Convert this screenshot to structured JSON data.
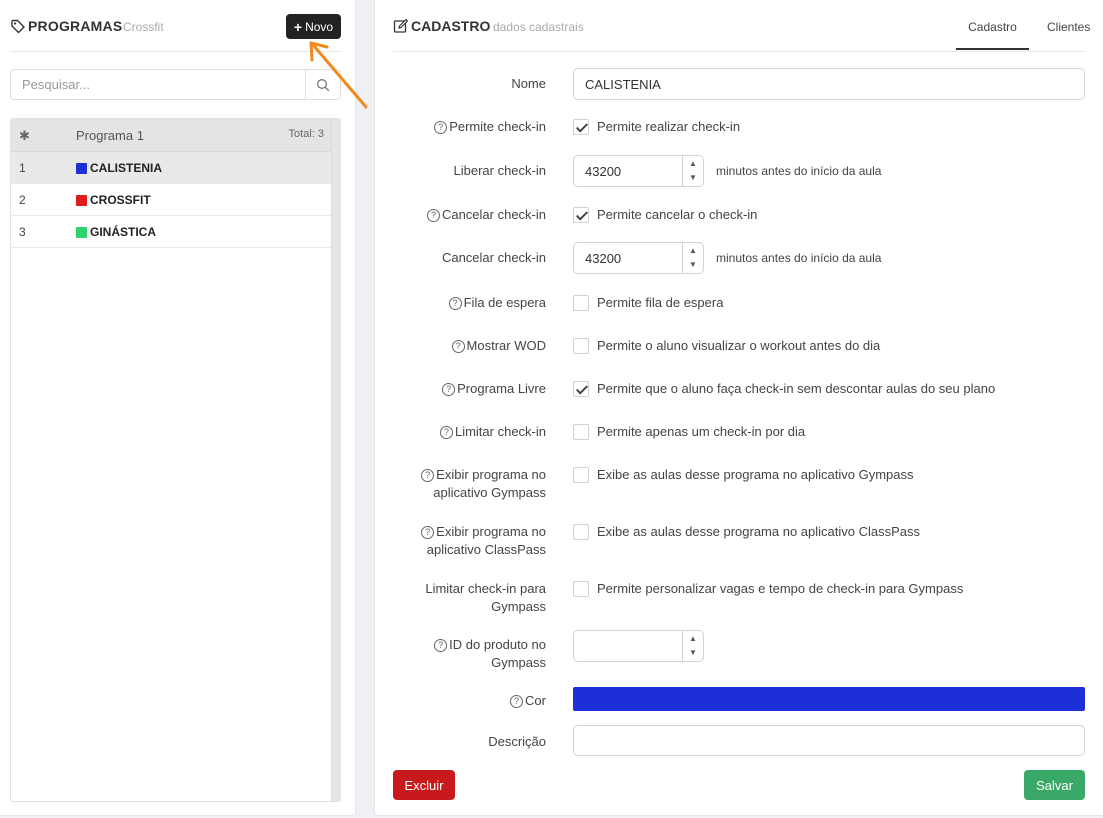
{
  "programs_panel": {
    "title": "PROGRAMAS",
    "subtitle": "Crossfit",
    "new_button": "Novo",
    "search_placeholder": "Pesquisar...",
    "list_header": {
      "column": "Programa 1",
      "total": "Total: 3"
    },
    "items": [
      {
        "num": "1",
        "name": "CALISTENIA",
        "color": "#1d30d8",
        "selected": true
      },
      {
        "num": "2",
        "name": "CROSSFIT",
        "color": "#e01b1b",
        "selected": false
      },
      {
        "num": "3",
        "name": "GINÁSTICA",
        "color": "#2ed36d",
        "selected": false
      }
    ]
  },
  "form_panel": {
    "title": "CADASTRO",
    "subtitle": "dados cadastrais",
    "tabs": [
      "Cadastro",
      "Clientes"
    ],
    "active_tab": "Cadastro",
    "fields": {
      "nome": {
        "label": "Nome",
        "value": "CALISTENIA"
      },
      "permite_checkin": {
        "label": "Permite check-in",
        "text": "Permite realizar check-in",
        "checked": true
      },
      "liberar_checkin": {
        "label": "Liberar check-in",
        "value": "43200",
        "unit": "minutos antes do início da aula"
      },
      "cancelar_checkin_flag": {
        "label": "Cancelar check-in",
        "text": "Permite cancelar o check-in",
        "checked": true
      },
      "cancelar_checkin_min": {
        "label": "Cancelar check-in",
        "value": "43200",
        "unit": "minutos antes do início da aula"
      },
      "fila_espera": {
        "label": "Fila de espera",
        "text": "Permite fila de espera",
        "checked": false
      },
      "mostrar_wod": {
        "label": "Mostrar WOD",
        "text": "Permite o aluno visualizar o workout antes do dia",
        "checked": false
      },
      "programa_livre": {
        "label": "Programa Livre",
        "text": "Permite que o aluno faça check-in sem descontar aulas do seu plano",
        "checked": true
      },
      "limitar_checkin": {
        "label": "Limitar check-in",
        "text": "Permite apenas um check-in por dia",
        "checked": false
      },
      "exibir_gympass": {
        "label_line1": "Exibir programa no",
        "label_line2": "aplicativo Gympass",
        "text": "Exibe as aulas desse programa no aplicativo Gympass",
        "checked": false
      },
      "exibir_classpass": {
        "label_line1": "Exibir programa no",
        "label_line2": "aplicativo ClassPass",
        "text": "Exibe as aulas desse programa no aplicativo ClassPass",
        "checked": false
      },
      "limitar_gympass": {
        "label_line1": "Limitar check-in para",
        "label_line2": "Gympass",
        "text": "Permite personalizar vagas e tempo de check-in para Gympass",
        "checked": false
      },
      "id_produto": {
        "label_line1": "ID do produto no",
        "label_line2": "Gympass",
        "value": ""
      },
      "cor": {
        "label": "Cor",
        "value": "#1d30d8"
      },
      "descricao": {
        "label": "Descrição",
        "value": ""
      }
    },
    "buttons": {
      "delete": "Excluir",
      "save": "Salvar"
    }
  },
  "colors": {
    "accent_arrow": "#f08a1c",
    "delete": "#c8191d",
    "save": "#3aa968"
  }
}
